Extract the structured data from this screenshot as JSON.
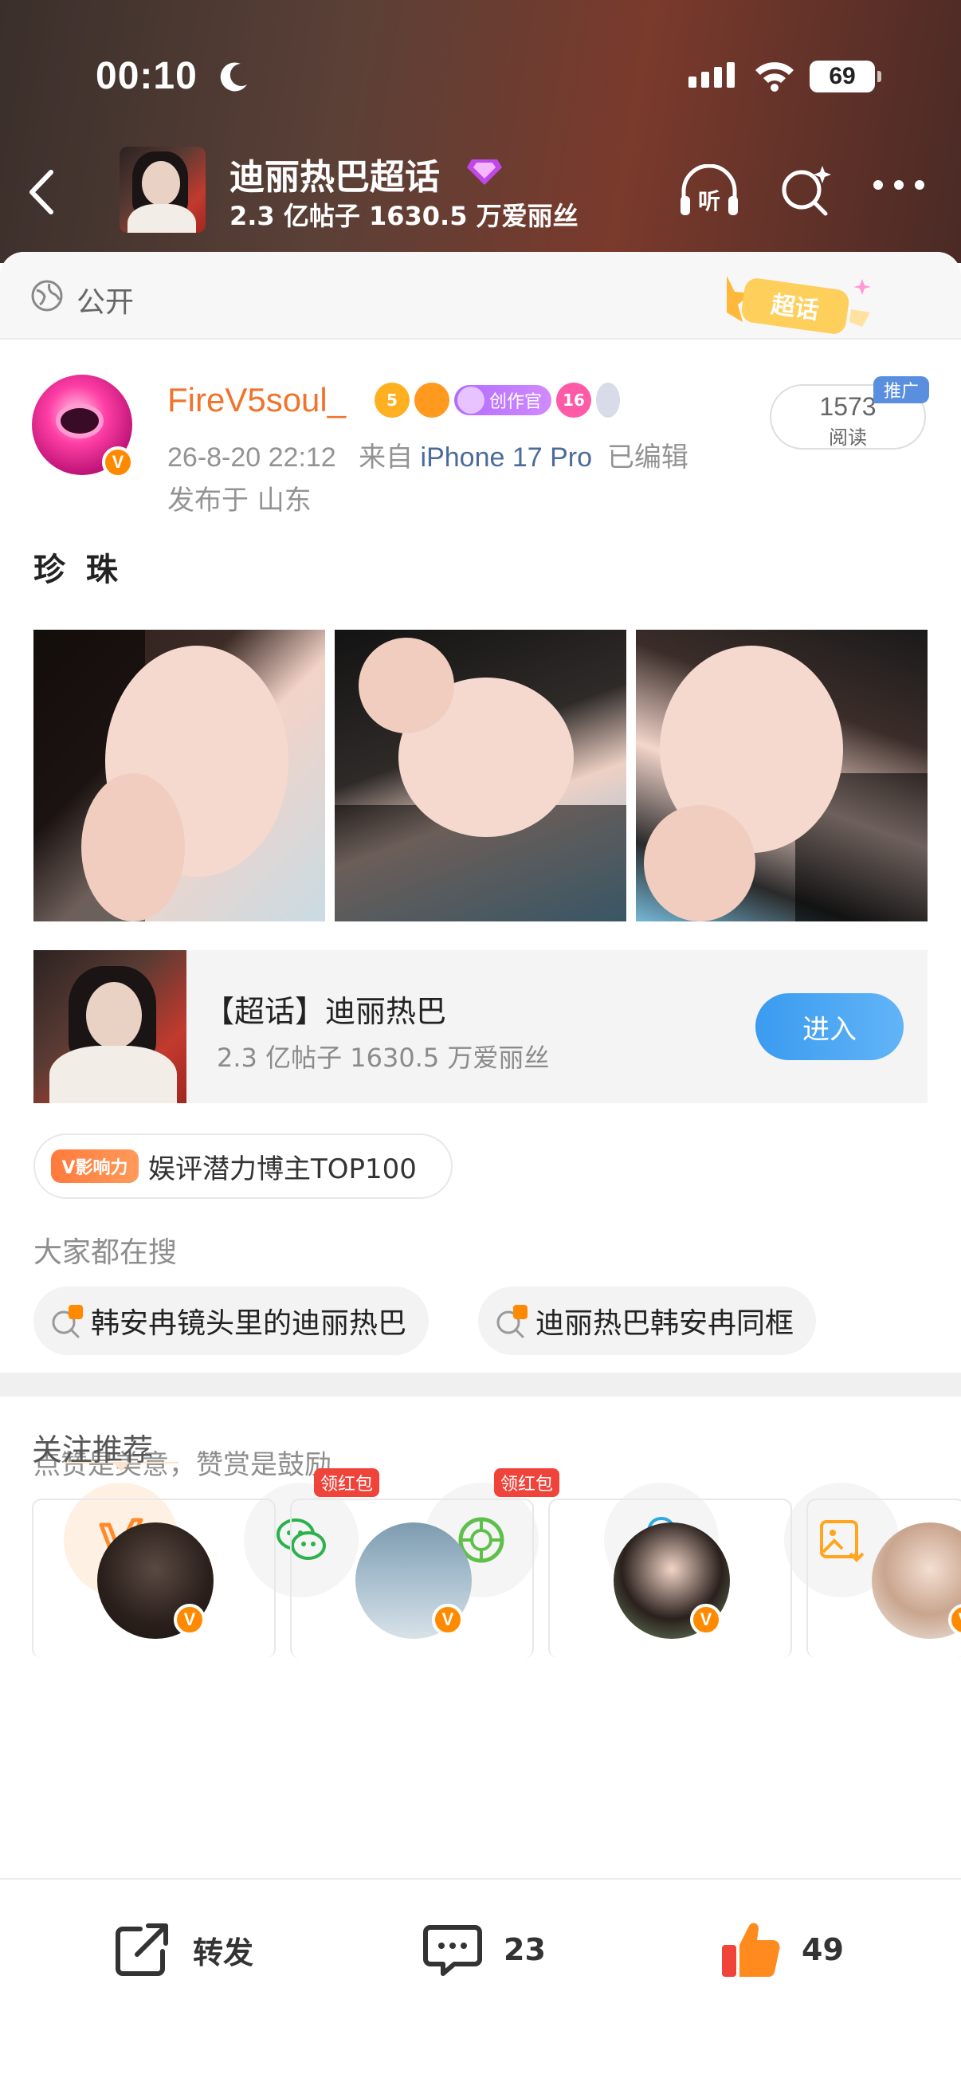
{
  "status_bar": {
    "time": "00:10",
    "battery": "69",
    "moon_icon": "moon-icon",
    "signal_icon": "signal-icon",
    "wifi_icon": "wifi-icon"
  },
  "header": {
    "title": "迪丽热巴超话",
    "stats": "2.3 亿帖子 1630.5 万爱丽丝",
    "back_icon": "chevron-left-icon",
    "listen_label": "听",
    "search_icon": "sparkle-search-icon",
    "more_icon": "more-horizontal-icon"
  },
  "visibility": {
    "label": "公开",
    "badge_text": "超话"
  },
  "post": {
    "author": "FireV5soul_",
    "creator_badge": "创作官",
    "level_badge": "5",
    "fan_level": "16",
    "timestamp": "26-8-20 22:12",
    "source_prefix": "来自",
    "device": "iPhone 17 Pro",
    "edited": "已编辑",
    "location": "发布于 山东",
    "reads_count": "1573",
    "reads_label": "阅读",
    "promo_tag": "推广",
    "text": "珍 珠",
    "photo_count": 3
  },
  "supertopic_card": {
    "title": "【超话】迪丽热巴",
    "stats": "2.3 亿帖子 1630.5 万爱丽丝",
    "enter_label": "进入"
  },
  "influence": {
    "tag": "V影响力",
    "text": "娱评潜力博主TOP100"
  },
  "trending": {
    "label": "大家都在搜",
    "items": [
      "韩安冉镜头里的迪丽热巴",
      "迪丽热巴韩安冉同框"
    ]
  },
  "reward": {
    "label": "点赞是美意，赞赏是鼓励"
  },
  "share": {
    "items": [
      {
        "name": "reward-icon",
        "badge": ""
      },
      {
        "name": "wechat-icon",
        "badge": "领红包"
      },
      {
        "name": "moments-icon",
        "badge": "领红包"
      },
      {
        "name": "qq-icon",
        "badge": ""
      },
      {
        "name": "save-image-icon",
        "badge": ""
      }
    ]
  },
  "recommend": {
    "title": "关注推荐"
  },
  "bottom_bar": {
    "repost_label": "转发",
    "comment_count": "23",
    "like_count": "49"
  },
  "colors": {
    "accent_orange": "#f0742c",
    "link_blue": "#4c6b9b",
    "enter_blue": "#3a9bf0",
    "redpack": "#f0433a"
  }
}
